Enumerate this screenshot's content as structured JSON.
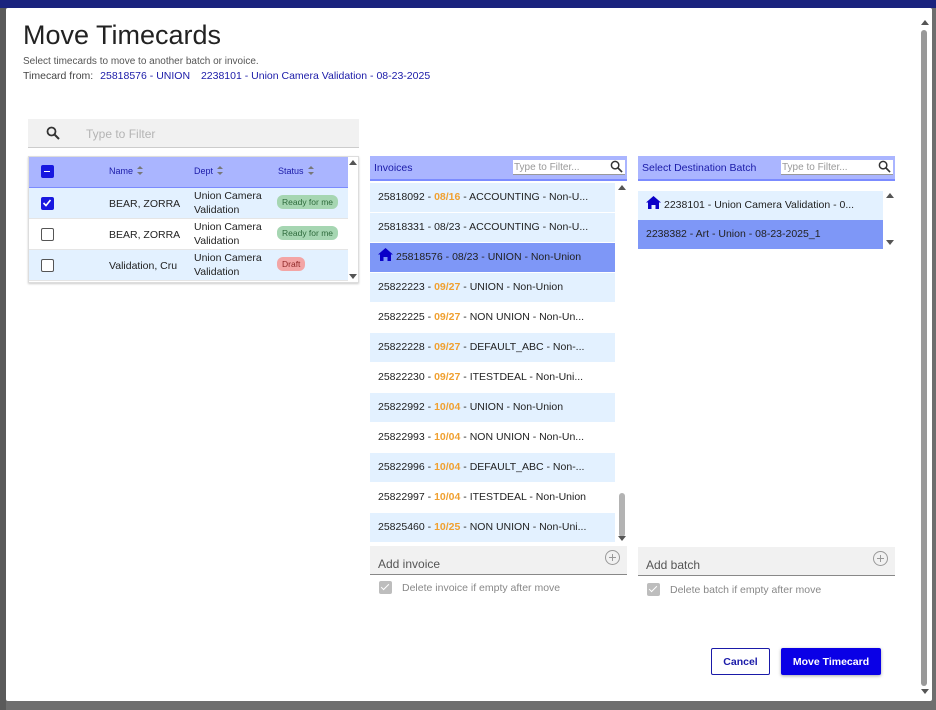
{
  "dialog": {
    "title": "Move Timecards",
    "subtitle": "Select timecards to move to another batch or invoice.",
    "from_label": "Timecard from:",
    "from_invoice": "25818576 - UNION",
    "from_batch": "2238101 - Union Camera Validation - 08-23-2025"
  },
  "timecards": {
    "filter_placeholder": "Type to Filter",
    "columns": {
      "name": "Name",
      "dept": "Dept",
      "status": "Status"
    },
    "rows": [
      {
        "name": "BEAR, ZORRA",
        "dept": "Union Camera Validation",
        "status": "Ready for me",
        "checked": true
      },
      {
        "name": "BEAR, ZORRA",
        "dept": "Union Camera Validation",
        "status": "Ready for me",
        "checked": false
      },
      {
        "name": "Validation, Cru",
        "dept": "Union Camera Validation",
        "status": "Draft",
        "checked": false
      }
    ]
  },
  "invoices": {
    "header": "Invoices",
    "filter_placeholder": "Type to Filter...",
    "items": [
      {
        "id": "25818092",
        "date": "08/16",
        "rest": "ACCOUNTING - Non-U..."
      },
      {
        "id": "25818331",
        "date": "08/23",
        "rest": "ACCOUNTING - Non-U..."
      },
      {
        "id": "25818576",
        "date": "08/23",
        "rest": "UNION - Non-Union"
      },
      {
        "id": "25822223",
        "date": "09/27",
        "rest": "UNION - Non-Union"
      },
      {
        "id": "25822225",
        "date": "09/27",
        "rest": "NON UNION - Non-Un..."
      },
      {
        "id": "25822228",
        "date": "09/27",
        "rest": "DEFAULT_ABC - Non-..."
      },
      {
        "id": "25822230",
        "date": "09/27",
        "rest": "ITESTDEAL - Non-Uni..."
      },
      {
        "id": "25822992",
        "date": "10/04",
        "rest": "UNION - Non-Union"
      },
      {
        "id": "25822993",
        "date": "10/04",
        "rest": "NON UNION - Non-Un..."
      },
      {
        "id": "25822996",
        "date": "10/04",
        "rest": "DEFAULT_ABC - Non-..."
      },
      {
        "id": "25822997",
        "date": "10/04",
        "rest": "ITESTDEAL - Non-Union"
      },
      {
        "id": "25825460",
        "date": "10/25",
        "rest": "NON UNION - Non-Uni..."
      }
    ],
    "add_label": "Add invoice",
    "delete_label": "Delete invoice if empty after move"
  },
  "batches": {
    "header": "Select Destination Batch",
    "filter_placeholder": "Type to Filter...",
    "items": [
      {
        "text": "2238101 - Union Camera Validation - 0..."
      },
      {
        "text": "2238382 - Art - Union - 08-23-2025_1"
      }
    ],
    "add_label": "Add batch",
    "delete_label": "Delete batch if empty after move"
  },
  "actions": {
    "cancel": "Cancel",
    "move": "Move Timecard"
  },
  "colors": {
    "primary": "#0a00e6",
    "header_bg": "#aab5ff",
    "highlight": "#7e97f7",
    "row_alt": "#e3f1ff",
    "date_accent": "#f0a030"
  },
  "icons": {
    "search": "search-icon",
    "home": "home-icon",
    "add": "add-circle-icon"
  }
}
